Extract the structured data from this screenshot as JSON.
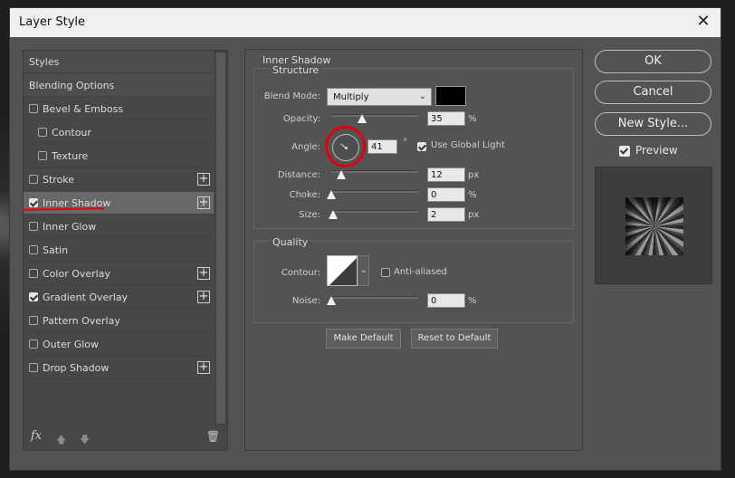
{
  "dialog": {
    "title": "Layer Style",
    "close_glyph": "✕"
  },
  "styles_list": {
    "items": [
      {
        "label": "Styles",
        "checkbox": false,
        "checked": false,
        "plus": false
      },
      {
        "label": "Blending Options",
        "checkbox": false,
        "checked": false,
        "plus": false
      },
      {
        "label": "Bevel & Emboss",
        "checkbox": true,
        "checked": false,
        "plus": false
      },
      {
        "label": "Contour",
        "checkbox": true,
        "checked": false,
        "plus": false,
        "indent": true
      },
      {
        "label": "Texture",
        "checkbox": true,
        "checked": false,
        "plus": false,
        "indent": true
      },
      {
        "label": "Stroke",
        "checkbox": true,
        "checked": false,
        "plus": true
      },
      {
        "label": "Inner Shadow",
        "checkbox": true,
        "checked": true,
        "plus": true,
        "selected": true
      },
      {
        "label": "Inner Glow",
        "checkbox": true,
        "checked": false,
        "plus": false
      },
      {
        "label": "Satin",
        "checkbox": true,
        "checked": false,
        "plus": false
      },
      {
        "label": "Color Overlay",
        "checkbox": true,
        "checked": false,
        "plus": true
      },
      {
        "label": "Gradient Overlay",
        "checkbox": true,
        "checked": true,
        "plus": true
      },
      {
        "label": "Pattern Overlay",
        "checkbox": true,
        "checked": false,
        "plus": false
      },
      {
        "label": "Outer Glow",
        "checkbox": true,
        "checked": false,
        "plus": false
      },
      {
        "label": "Drop Shadow",
        "checkbox": true,
        "checked": false,
        "plus": true
      }
    ],
    "plus_glyph": "+",
    "footer": {
      "fx_label": "fx",
      "up_glyph": "🡅",
      "down_glyph": "🡇",
      "trash_glyph": "🗑"
    }
  },
  "inner_shadow": {
    "section_title": "Inner Shadow",
    "structure": {
      "title": "Structure",
      "blend_mode_label": "Blend Mode:",
      "blend_mode_value": "Multiply",
      "shadow_color": "#000000",
      "opacity_label": "Opacity:",
      "opacity_value": "35",
      "opacity_unit": "%",
      "opacity_level": 0.35,
      "angle_label": "Angle:",
      "angle_value": "41",
      "angle_unit": "°",
      "use_global_light_label": "Use Global Light",
      "use_global_light_checked": true,
      "distance_label": "Distance:",
      "distance_value": "12",
      "distance_unit": "px",
      "choke_label": "Choke:",
      "choke_value": "0",
      "choke_unit": "%",
      "size_label": "Size:",
      "size_value": "2",
      "size_unit": "px"
    },
    "quality": {
      "title": "Quality",
      "contour_label": "Contour:",
      "anti_aliased_label": "Anti-aliased",
      "anti_aliased_checked": false,
      "noise_label": "Noise:",
      "noise_value": "0",
      "noise_unit": "%"
    },
    "make_default_label": "Make Default",
    "reset_default_label": "Reset to Default"
  },
  "actions": {
    "ok_label": "OK",
    "cancel_label": "Cancel",
    "new_style_label": "New Style...",
    "preview_label": "Preview",
    "preview_checked": true
  },
  "annotation": {
    "color": "#e3000b"
  }
}
